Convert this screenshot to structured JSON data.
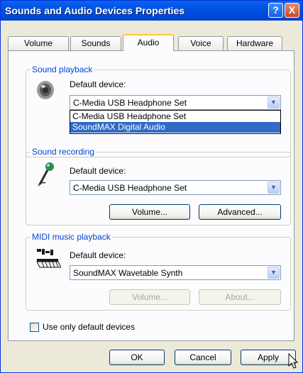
{
  "window": {
    "title": "Sounds and Audio Devices Properties"
  },
  "titlebar": {
    "help_label": "?",
    "close_label": "X"
  },
  "tabs": [
    {
      "label": "Volume"
    },
    {
      "label": "Sounds"
    },
    {
      "label": "Audio"
    },
    {
      "label": "Voice"
    },
    {
      "label": "Hardware"
    }
  ],
  "active_tab": "Audio",
  "playback": {
    "legend": "Sound playback",
    "device_label": "Default device:",
    "selected": "C-Media USB Headphone Set",
    "options": [
      "C-Media USB Headphone Set",
      "SoundMAX Digital Audio"
    ],
    "highlighted": "SoundMAX Digital Audio",
    "icon": "speaker-icon"
  },
  "recording": {
    "legend": "Sound recording",
    "device_label": "Default device:",
    "selected": "C-Media USB Headphone Set",
    "volume_label": "Volume...",
    "advanced_label": "Advanced...",
    "icon": "microphone-icon"
  },
  "midi": {
    "legend": "MIDI music playback",
    "device_label": "Default device:",
    "selected": "SoundMAX Wavetable Synth",
    "volume_label": "Volume...",
    "about_label": "About...",
    "icon": "midi-keyboard-icon"
  },
  "use_default_label": "Use only default devices",
  "footer": {
    "ok": "OK",
    "cancel": "Cancel",
    "apply": "Apply"
  },
  "colors": {
    "titlebar": "#0053E4",
    "accent": "#316AC5",
    "group_label": "#0046D5",
    "tab_highlight": "#FFC83C"
  }
}
